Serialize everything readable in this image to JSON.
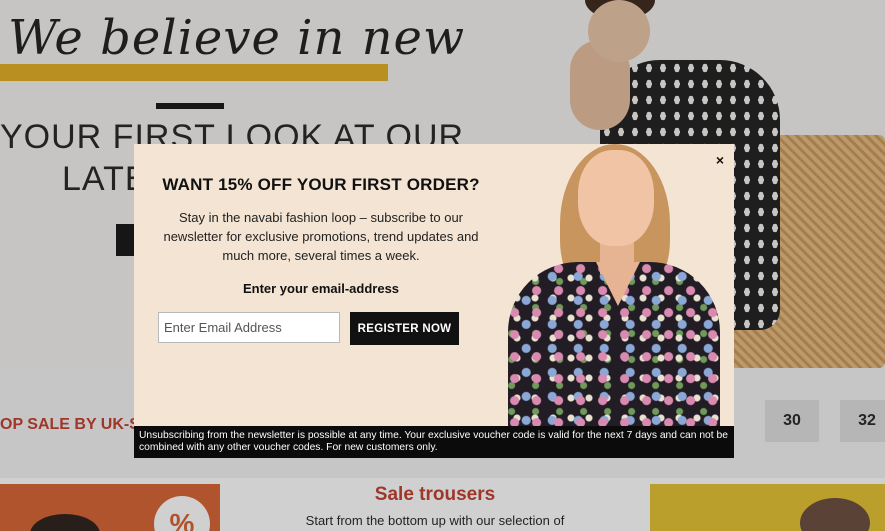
{
  "hero": {
    "script_heading": "We believe in new",
    "line1": "YOUR FIRST LOOK AT OUR",
    "line2": "LATE"
  },
  "size_section": {
    "label": "OP SALE BY UK-SIZ",
    "sizes": [
      "30",
      "32"
    ]
  },
  "promo_card": {
    "percent_symbol": "%"
  },
  "sale_section": {
    "title": "Sale trousers",
    "description": "Start from the bottom up with our selection of"
  },
  "modal": {
    "close_symbol": "×",
    "title": "WANT 15% OFF YOUR FIRST ORDER?",
    "body": "Stay in the navabi fashion loop – subscribe to our newsletter for exclusive promotions, trend updates and much more, several times a week.",
    "email_label": "Enter your email-address",
    "email_placeholder": "Enter Email Address",
    "email_value": "",
    "register_label": "REGISTER NOW",
    "disclaimer": "Unsubscribing from the newsletter is possible at any time. Your exclusive voucher code is valid for the next 7 days and can not be combined with any other voucher codes. For new customers only."
  },
  "colors": {
    "accent_yellow": "#e0ac1e",
    "sale_red": "#c23a2a",
    "modal_bg": "#f3e4d3",
    "button_black": "#111111"
  }
}
